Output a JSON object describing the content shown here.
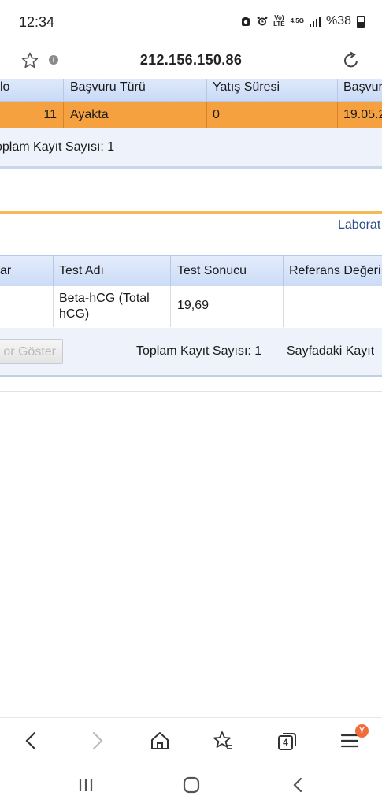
{
  "status_bar": {
    "time": "12:34",
    "volte_label_top": "Vo)",
    "volte_label_bottom": "LTE",
    "network_label": "4.5G",
    "battery_text": "%38"
  },
  "address_bar": {
    "url": "212.156.150.86"
  },
  "table1": {
    "headers": [
      "lo",
      "Başvuru Türü",
      "Yatış Süresi",
      "Başvur"
    ],
    "row": [
      "11",
      "Ayakta",
      "0",
      "19.05.2"
    ],
    "footer": "oplam Kayıt Sayısı: 1"
  },
  "lab_label": "Laborat",
  "table2": {
    "headers": [
      "ar",
      "Test Adı",
      "Test Sonucu",
      "Referans Değeri"
    ],
    "row": [
      "",
      "Beta-hCG (Total hCG)",
      "19,69",
      ""
    ],
    "button": "or Göster",
    "total": "Toplam Kayıt Sayısı: 1",
    "page_info": "Sayfadaki Kayıt"
  },
  "toolbar": {
    "tabs_count": "4",
    "profile_badge": "Y"
  }
}
